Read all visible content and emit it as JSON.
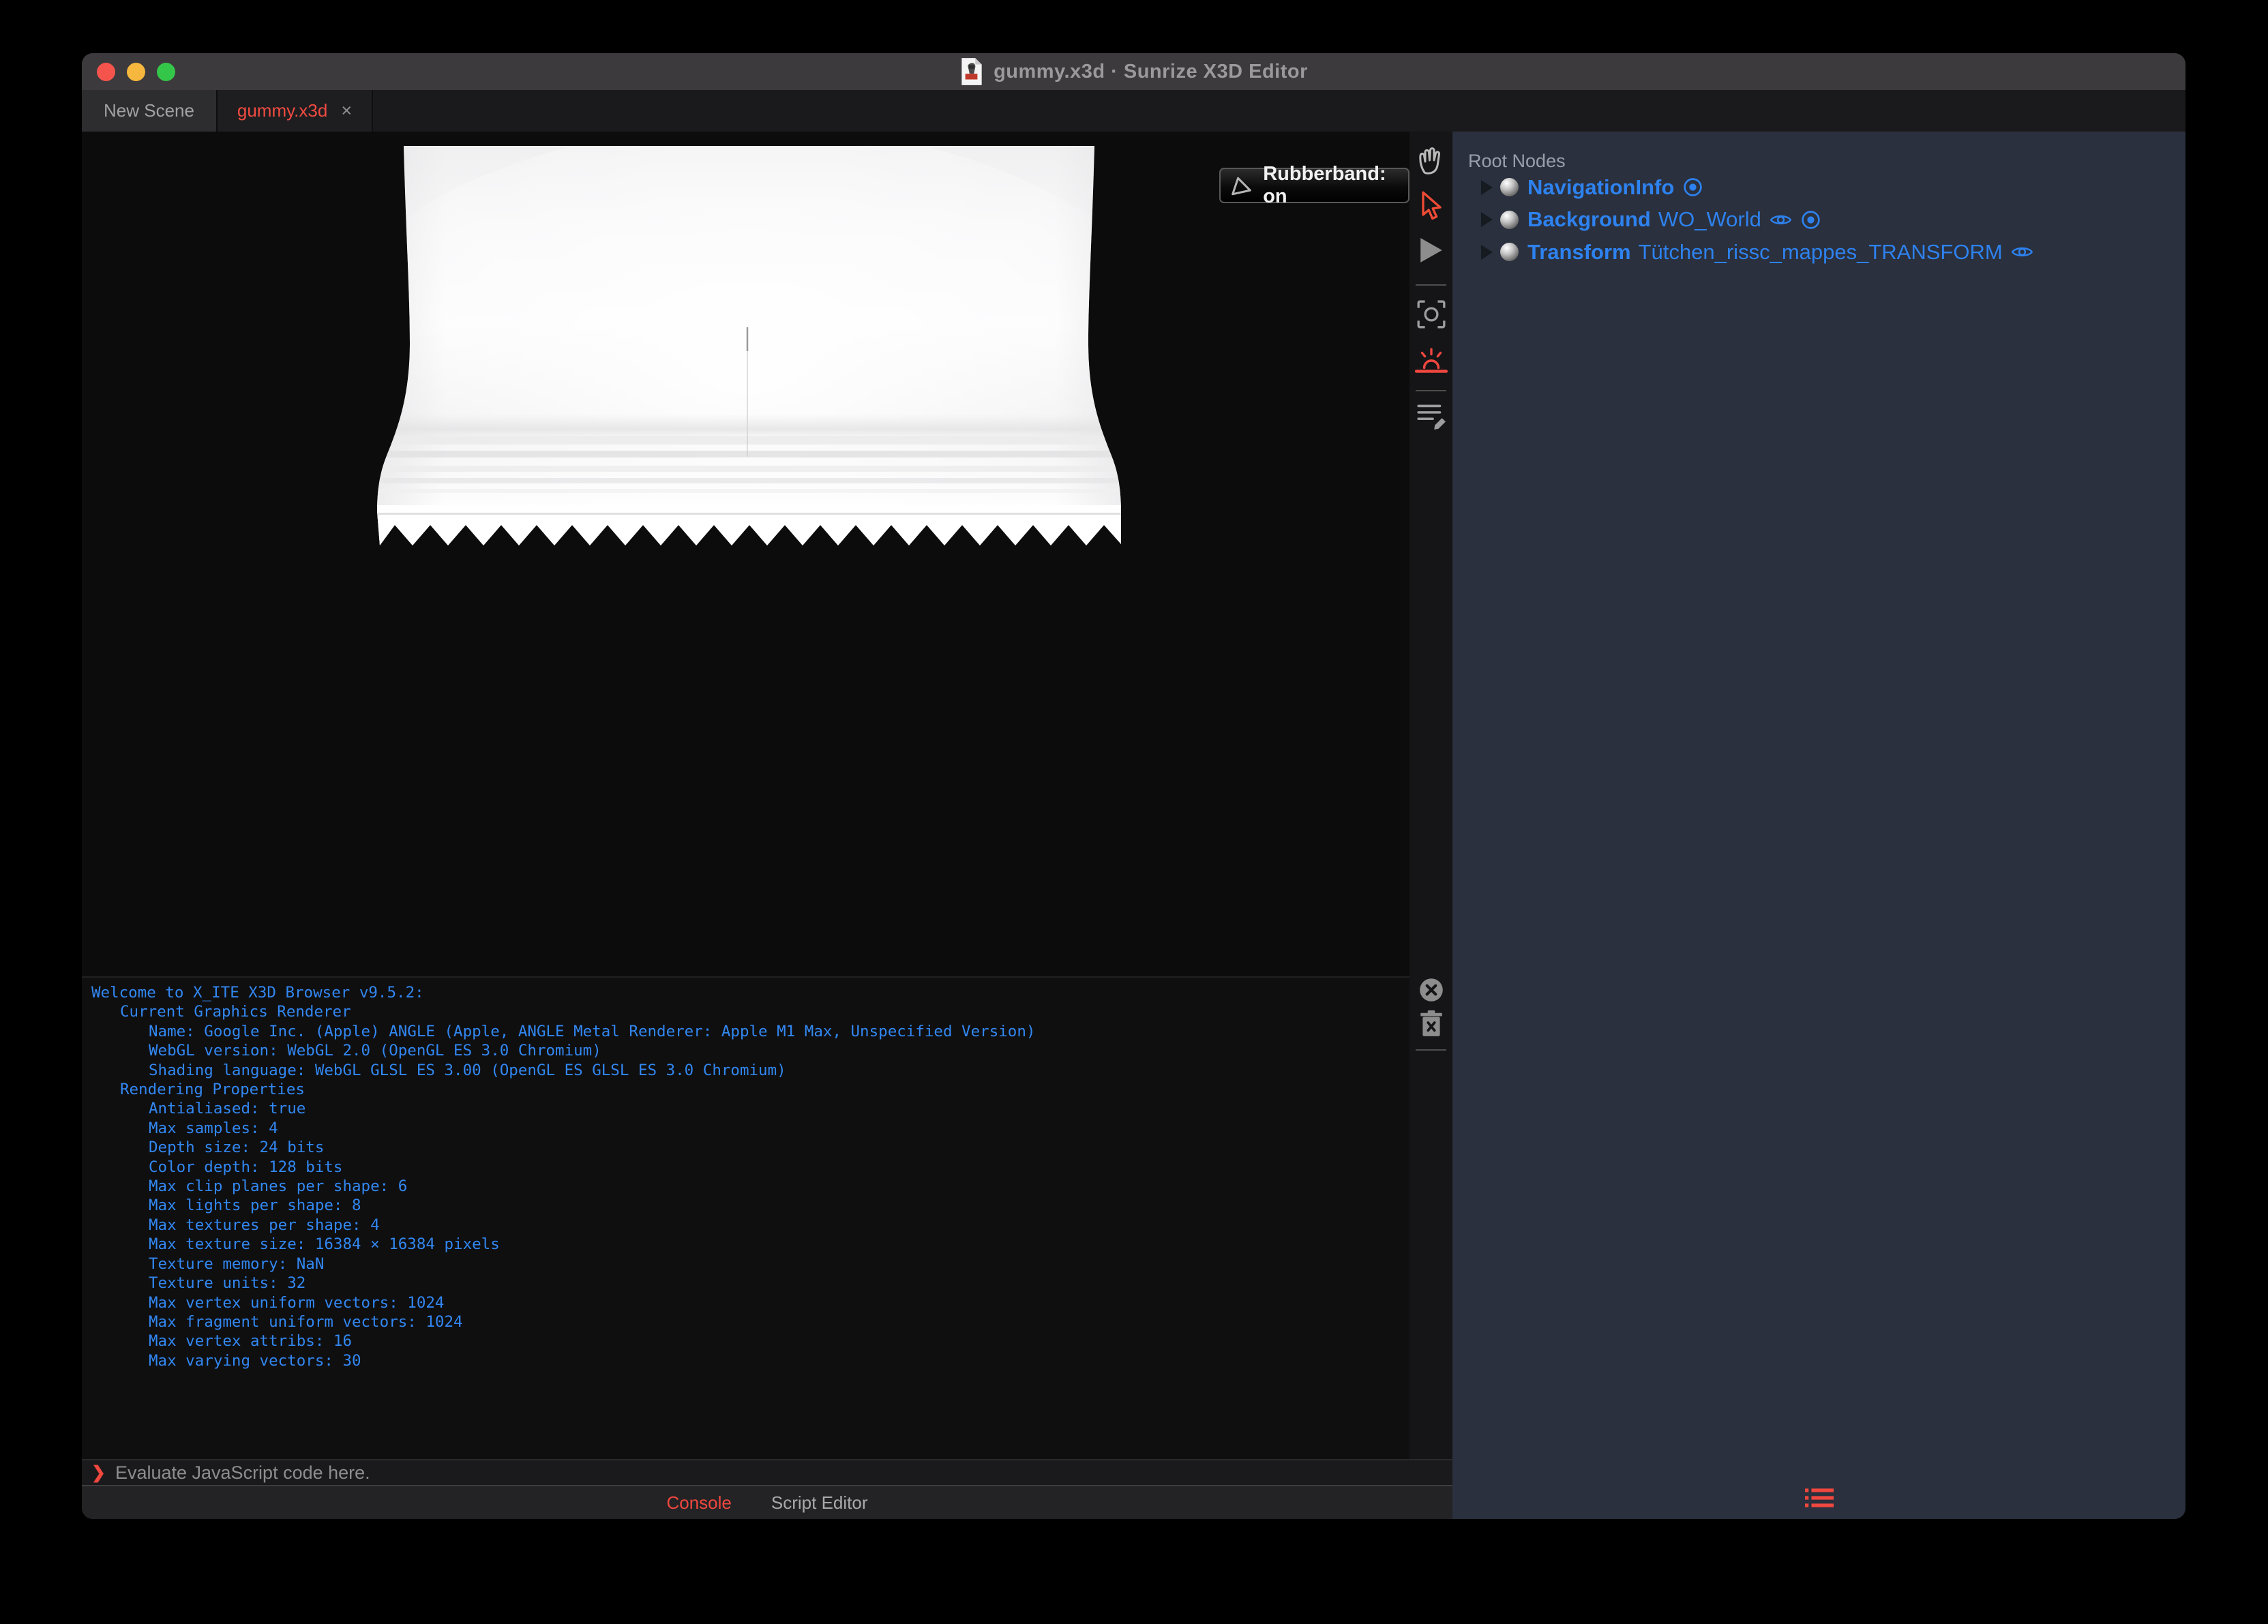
{
  "window": {
    "title": "gummy.x3d · Sunrize X3D Editor"
  },
  "tab_bar": {
    "tabs": [
      {
        "label": "New Scene",
        "active": false
      },
      {
        "label": "gummy.x3d",
        "close_label": "×",
        "active": true
      }
    ]
  },
  "viewport": {
    "rubberband_tooltip": "Rubberband: on"
  },
  "side_toolbar": {
    "tools": [
      "pan-hand",
      "select-arrow",
      "play",
      "viewfinder-snapshot",
      "sunrise-environment",
      "script-list"
    ],
    "console_tools": [
      "clear-console",
      "delete-console"
    ]
  },
  "outline_editor": {
    "header": "Root Nodes",
    "nodes": [
      {
        "type": "NavigationInfo",
        "name": "",
        "bound": true,
        "visible_eye": false
      },
      {
        "type": "Background",
        "name": "WO_World",
        "bound": true,
        "visible_eye": true
      },
      {
        "type": "Transform",
        "name": "Tütchen_rissc_mappes_TRANSFORM",
        "bound": false,
        "visible_eye": true
      }
    ]
  },
  "console": {
    "lines": [
      {
        "indent": 0,
        "text": "Welcome to X_ITE X3D Browser v9.5.2:"
      },
      {
        "indent": 1,
        "text": "Current Graphics Renderer"
      },
      {
        "indent": 2,
        "text": "Name: Google Inc. (Apple) ANGLE (Apple, ANGLE Metal Renderer: Apple M1 Max, Unspecified Version)"
      },
      {
        "indent": 2,
        "text": "WebGL version: WebGL 2.0 (OpenGL ES 3.0 Chromium)"
      },
      {
        "indent": 2,
        "text": "Shading language: WebGL GLSL ES 3.00 (OpenGL ES GLSL ES 3.0 Chromium)"
      },
      {
        "indent": 1,
        "text": "Rendering Properties"
      },
      {
        "indent": 2,
        "text": "Antialiased: true"
      },
      {
        "indent": 2,
        "text": "Max samples: 4"
      },
      {
        "indent": 2,
        "text": "Depth size: 24 bits"
      },
      {
        "indent": 2,
        "text": "Color depth: 128 bits"
      },
      {
        "indent": 2,
        "text": "Max clip planes per shape: 6"
      },
      {
        "indent": 2,
        "text": "Max lights per shape: 8"
      },
      {
        "indent": 2,
        "text": "Max textures per shape: 4"
      },
      {
        "indent": 2,
        "text": "Max texture size: 16384 × 16384 pixels"
      },
      {
        "indent": 2,
        "text": "Texture memory: NaN"
      },
      {
        "indent": 2,
        "text": "Texture units: 32"
      },
      {
        "indent": 2,
        "text": "Max vertex uniform vectors: 1024"
      },
      {
        "indent": 2,
        "text": "Max fragment uniform vectors: 1024"
      },
      {
        "indent": 2,
        "text": "Max vertex attribs: 16"
      },
      {
        "indent": 2,
        "text": "Max varying vectors: 30"
      }
    ],
    "prompt": "❯",
    "input_placeholder": "Evaluate JavaScript code here."
  },
  "bottom_tabs": {
    "console_label": "Console",
    "script_editor_label": "Script Editor"
  },
  "colors": {
    "accent_red": "#f0473f",
    "console_blue": "#3287f1",
    "node_blue": "#2e82ef",
    "panel_bg": "#2a303d",
    "titlebar_bg": "#3d3a3d"
  }
}
